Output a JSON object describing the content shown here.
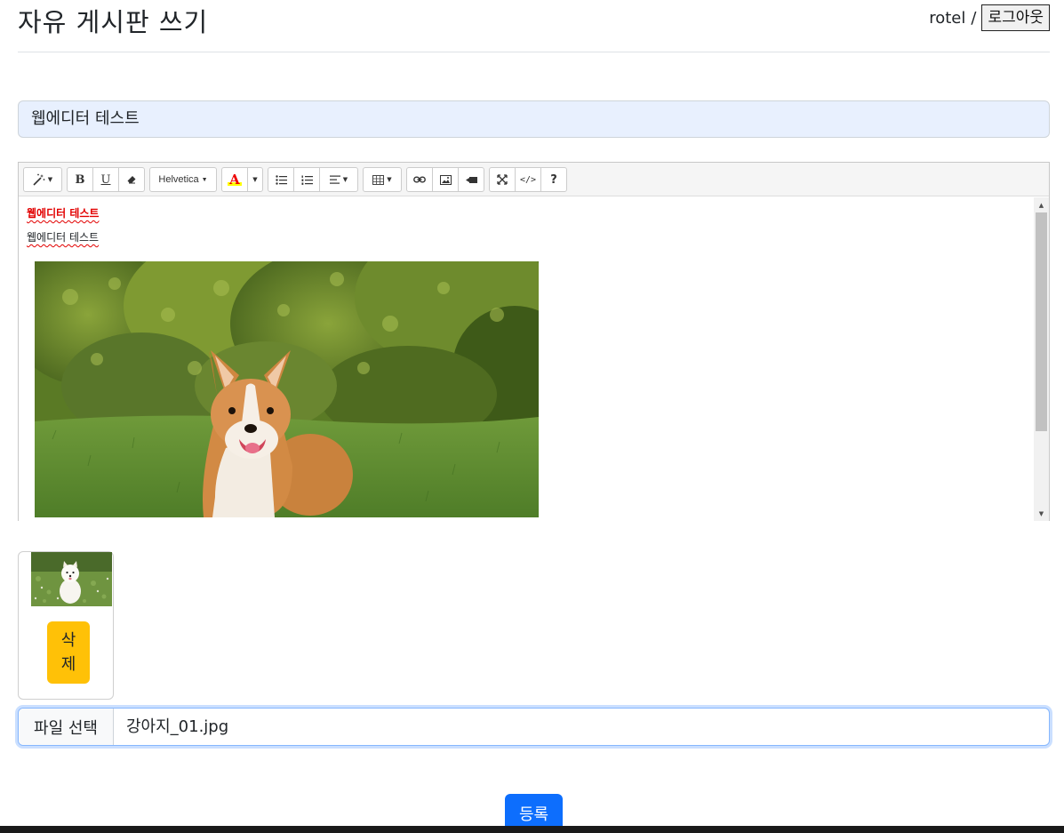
{
  "header": {
    "title": "자유 게시판 쓰기",
    "username": "rotel",
    "separator": "/",
    "logout_label": "로그아웃"
  },
  "post": {
    "title_value": "웹에디터 테스트"
  },
  "editor": {
    "toolbar": {
      "font_name": "Helvetica",
      "color_letter": "A",
      "bold_letter": "B",
      "underline_letter": "U",
      "code_label": "</>",
      "help_label": "?"
    },
    "content": {
      "line1": "웹에디터 테스트",
      "line1_color": "#e20000",
      "line2": "웹에디터 테스트"
    },
    "icons": [
      "magic-wand-icon",
      "bold-icon",
      "underline-icon",
      "eraser-icon",
      "font-name-dropdown",
      "text-color-icon",
      "unordered-list-icon",
      "ordered-list-icon",
      "align-icon",
      "table-icon",
      "link-icon",
      "picture-icon",
      "video-icon",
      "fullscreen-icon",
      "code-view-icon",
      "help-icon"
    ]
  },
  "attachments": {
    "delete_label": "삭제"
  },
  "file_input": {
    "button_label": "파일 선택",
    "file_name": "강아지_01.jpg"
  },
  "actions": {
    "submit_label": "등록"
  },
  "colors": {
    "primary": "#0d6efd",
    "warning": "#ffc107",
    "title_input_bg": "#e8f0fe"
  }
}
